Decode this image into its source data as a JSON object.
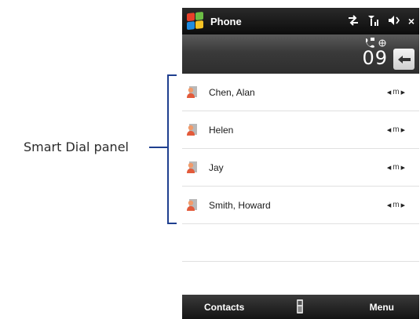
{
  "annotation": {
    "label": "Smart Dial panel"
  },
  "title_bar": {
    "title": "Phone",
    "icons": [
      "windows-start-icon",
      "connectivity-icon",
      "signal-icon",
      "volume-icon",
      "close-icon"
    ],
    "close_glyph": "×"
  },
  "dial_bar": {
    "number": "09",
    "icons": [
      "speaker-phone-icon",
      "globe-icon",
      "backspace-icon"
    ]
  },
  "contacts": [
    {
      "name": "Chen, Alan",
      "type": "m"
    },
    {
      "name": "Helen",
      "type": "m"
    },
    {
      "name": "Jay",
      "type": "m"
    },
    {
      "name": "Smith, Howard",
      "type": "m"
    }
  ],
  "softkeys": {
    "left": "Contacts",
    "right": "Menu",
    "middle_icon": "keyboard-icon"
  },
  "colors": {
    "annotation_line": "#1f3f8f",
    "title_bar": "#111111",
    "dial_bar": "#3a3a3a"
  }
}
